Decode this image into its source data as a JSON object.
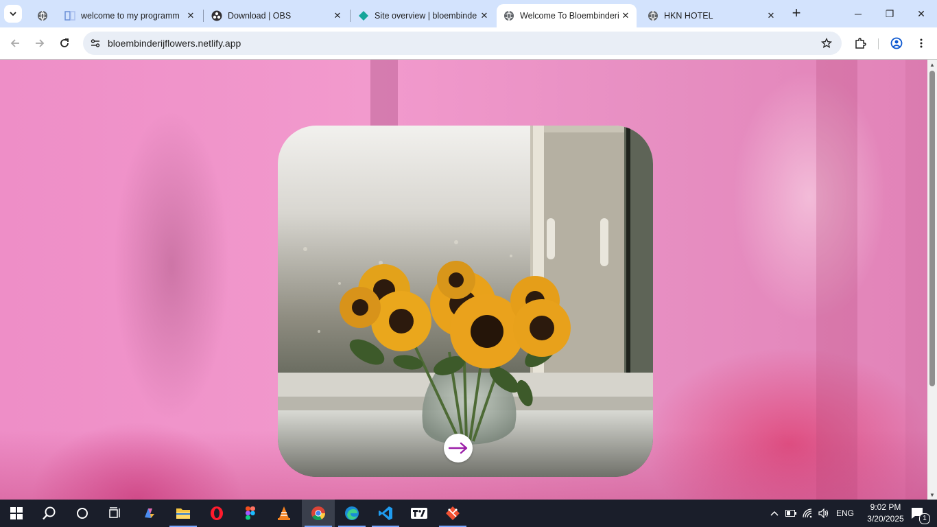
{
  "browser": {
    "tabs": [
      {
        "title": "welcome to my programm",
        "favicon": "globe-icon",
        "active": false
      },
      {
        "title": "Download | OBS",
        "favicon": "obs-icon",
        "active": false
      },
      {
        "title": "Site overview | bloembinde",
        "favicon": "netlify-icon",
        "active": false
      },
      {
        "title": "Welcome To Bloembinderij",
        "favicon": "globe-icon",
        "active": true
      },
      {
        "title": "HKN HOTEL",
        "favicon": "globe-icon",
        "active": false
      }
    ],
    "pinned_tab_favicon": "globe-icon",
    "new_tab_symbol": "+",
    "url": "bloembinderijflowers.netlify.app",
    "window_controls": {
      "minimize": "─",
      "maximize": "❐",
      "close": "✕"
    }
  },
  "page": {
    "background_tint": "#ef93c9",
    "hero_image": "sunflowers-in-vase-by-window",
    "next_button_icon": "arrow-right-icon",
    "accent_color": "#9b1fa8"
  },
  "taskbar": {
    "apps": [
      "start",
      "search",
      "cortana",
      "task-view",
      "copilot",
      "file-explorer",
      "opera",
      "figma",
      "vlc",
      "chrome",
      "edge",
      "vscode",
      "tradingview",
      "git"
    ],
    "active_app": "chrome",
    "language": "ENG",
    "time": "9:02 PM",
    "date": "3/20/2025",
    "notification_count": "1"
  }
}
